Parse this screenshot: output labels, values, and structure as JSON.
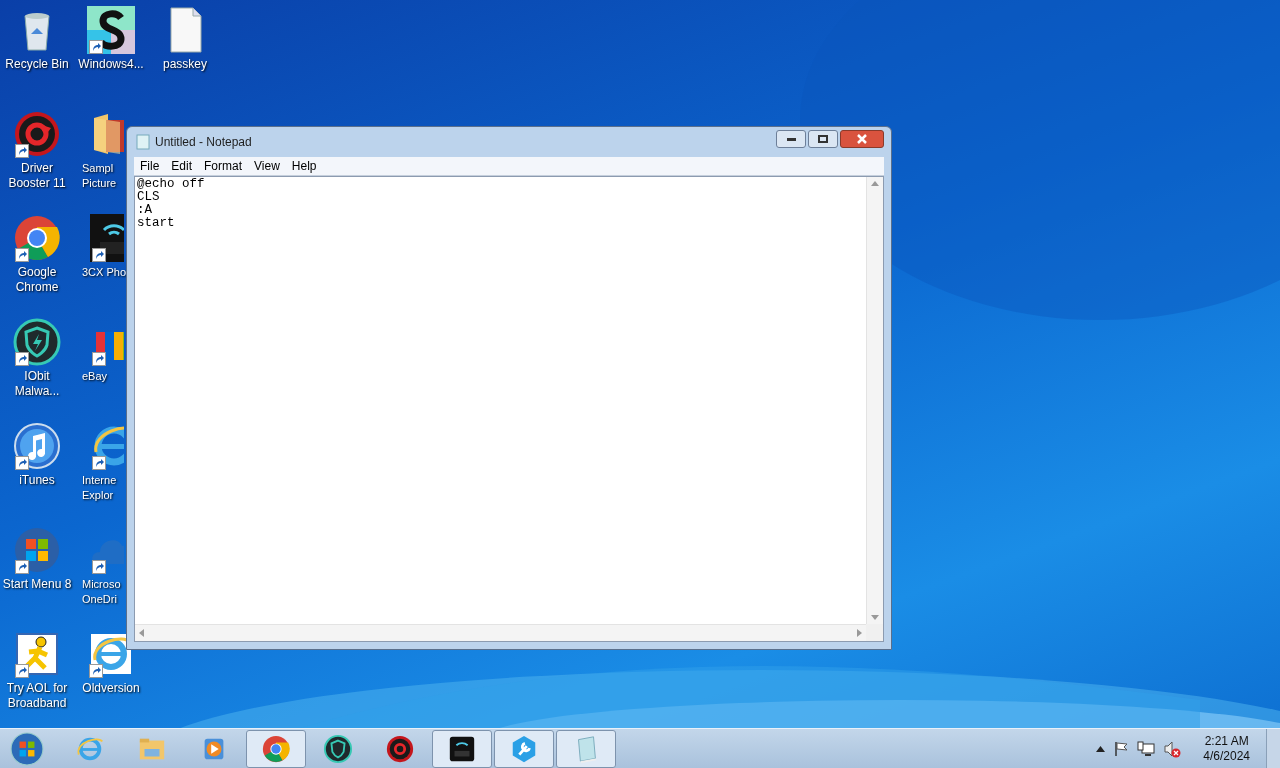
{
  "desktop": {
    "columns": [
      [
        {
          "lines": [
            "Recycle Bin"
          ],
          "shortcut": false
        },
        {
          "lines": [
            "Driver",
            "Booster 11"
          ],
          "shortcut": true
        },
        {
          "lines": [
            "Google",
            "Chrome"
          ],
          "shortcut": true
        },
        {
          "lines": [
            "IObit",
            "Malwa..."
          ],
          "shortcut": true
        },
        {
          "lines": [
            "iTunes"
          ],
          "shortcut": true
        },
        {
          "lines": [
            "Start Menu 8"
          ],
          "shortcut": true
        },
        {
          "lines": [
            "Try AOL for",
            "Broadband"
          ],
          "shortcut": true
        }
      ],
      [
        {
          "lines": [
            "Windows4..."
          ],
          "shortcut": true
        },
        {
          "lines": [
            "Sampl",
            "Picture"
          ],
          "shortcut": false
        },
        {
          "lines": [
            "3CX Pho"
          ],
          "shortcut": true
        },
        {
          "lines": [
            "eBay"
          ],
          "shortcut": true
        },
        {
          "lines": [
            "Interne",
            "Explor"
          ],
          "shortcut": true
        },
        {
          "lines": [
            "Microso",
            "OneDri"
          ],
          "shortcut": true
        },
        {
          "lines": [
            "Oldversion"
          ],
          "shortcut": true
        }
      ],
      [
        {
          "lines": [
            "passkey"
          ],
          "shortcut": false
        }
      ]
    ]
  },
  "notepad": {
    "title": "Untitled - Notepad",
    "menu": [
      "File",
      "Edit",
      "Format",
      "View",
      "Help"
    ],
    "lines": [
      "@echo off",
      "CLS",
      ":A",
      "start"
    ]
  },
  "taskbar": {
    "items": [
      {
        "open": false
      },
      {
        "open": false
      },
      {
        "open": false
      },
      {
        "open": true
      },
      {
        "open": false
      },
      {
        "open": false
      },
      {
        "open": true
      },
      {
        "open": true
      },
      {
        "open": true
      }
    ],
    "clock": {
      "time": "2:21 AM",
      "date": "4/6/2024"
    }
  }
}
